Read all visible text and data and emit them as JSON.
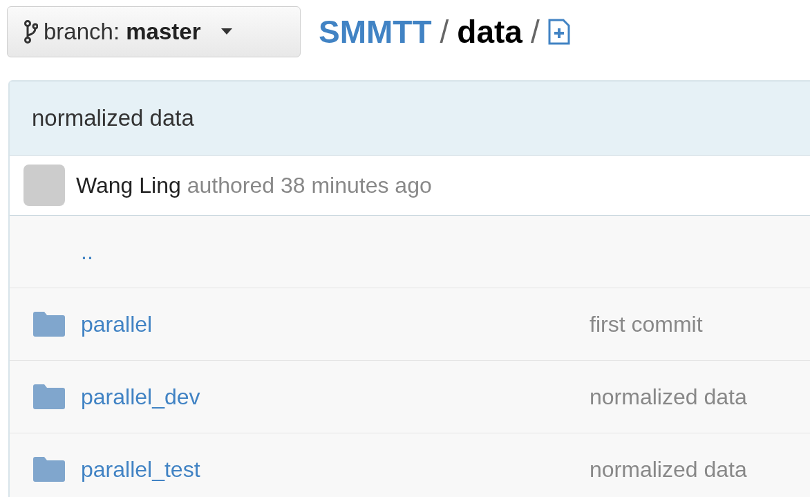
{
  "branch_button": {
    "label": "branch:",
    "branch": "master"
  },
  "breadcrumb": {
    "repo": "SMMTT",
    "separator_1": "/",
    "path": "data",
    "separator_2": "/"
  },
  "commit": {
    "message": "normalized data",
    "author": "Wang Ling",
    "meta": "authored 38 minutes ago"
  },
  "files": [
    {
      "kind": "parent",
      "name": ".."
    },
    {
      "kind": "folder",
      "name": "parallel",
      "message": "first commit"
    },
    {
      "kind": "folder",
      "name": "parallel_dev",
      "message": "normalized data"
    },
    {
      "kind": "folder",
      "name": "parallel_test",
      "message": "normalized data"
    }
  ]
}
